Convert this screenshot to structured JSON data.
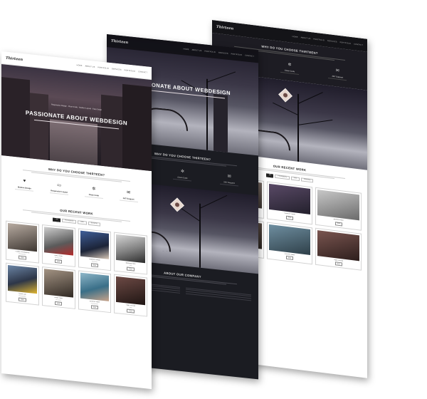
{
  "brand": "Thirteen",
  "nav": [
    "HOME",
    "ABOUT US",
    "PORTFOLIO",
    "SERVICES",
    "PORTFOLIO",
    "CONTACT"
  ],
  "hero": {
    "title": "PASSIONATE ABOUT WEBDESIGN",
    "subtitle": "Responsive Design · Clean Code · Modern Layout · Easy Setup"
  },
  "why": {
    "title": "WHY DO YOU CHOOSE THIRTEEN?",
    "features": [
      {
        "icon": "heart-icon",
        "label": "Modern Design"
      },
      {
        "icon": "monitor-icon",
        "label": "Responsive Layout"
      },
      {
        "icon": "gear-icon",
        "label": "Clean Code"
      },
      {
        "icon": "chat-icon",
        "label": "24/7 Support"
      }
    ]
  },
  "work": {
    "title": "OUR RECENT WORK",
    "filters": [
      "All",
      "Photography",
      "Web",
      "Branding"
    ],
    "items": [
      {
        "caption": "Couple Photography",
        "category": "Photography",
        "button": "View"
      },
      {
        "caption": "Paris Street",
        "category": "Photography",
        "button": "View"
      },
      {
        "caption": "Fashion Portrait",
        "category": "Branding",
        "button": "View"
      },
      {
        "caption": "Business Man",
        "category": "Web",
        "button": "View"
      },
      {
        "caption": "Yellow Cab",
        "category": "Photography",
        "button": "View"
      },
      {
        "caption": "Urban Style",
        "category": "Branding",
        "button": "View"
      },
      {
        "caption": "Summer Water",
        "category": "Photography",
        "button": "View"
      },
      {
        "caption": "Night Portrait",
        "category": "Web",
        "button": "View"
      }
    ]
  },
  "about": {
    "title": "ABOUT OUR COMPANY"
  },
  "colors": {
    "dark_bg": "#1b1c22",
    "light_bg": "#ffffff",
    "accent_dark": "#222222"
  }
}
